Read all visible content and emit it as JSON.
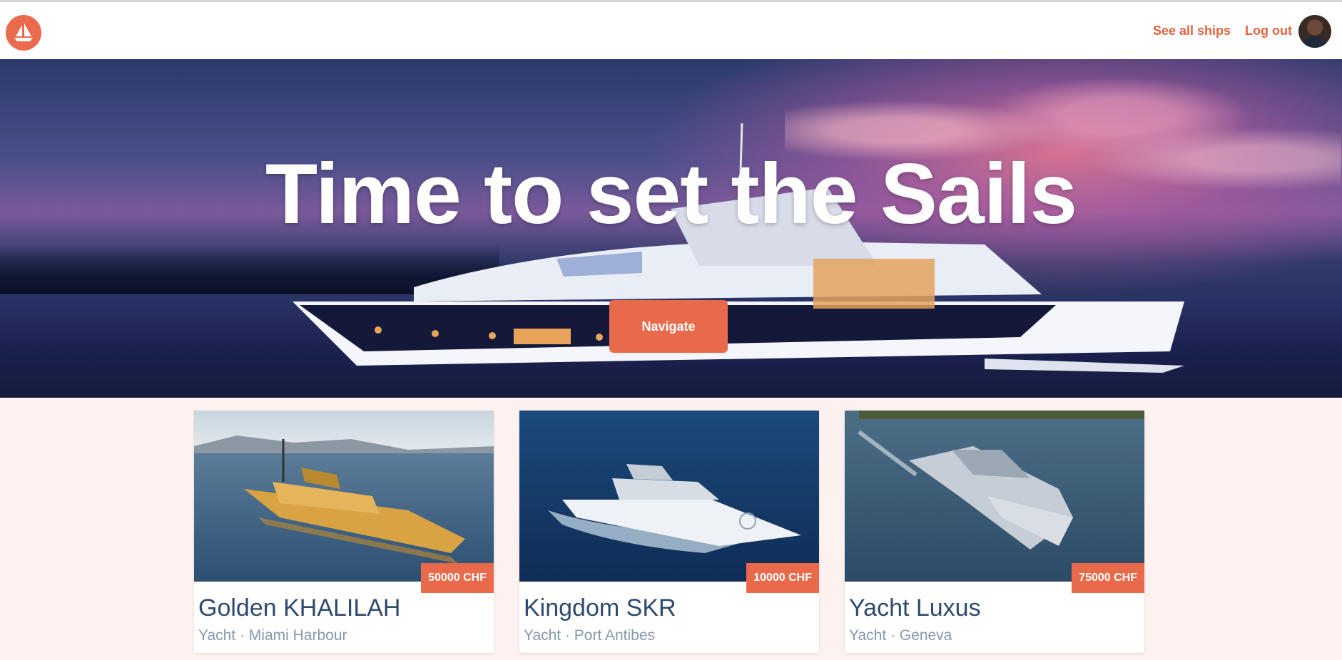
{
  "header": {
    "logo_icon": "sailboat-logo-icon",
    "nav": {
      "see_all_ships": "See all ships",
      "log_out": "Log out"
    },
    "avatar_icon": "user-avatar-icon"
  },
  "hero": {
    "title": "Time to set the Sails",
    "button_label": "Navigate"
  },
  "ships": [
    {
      "name": "Golden KHALILAH",
      "subtitle": "Yacht · Miami Harbour",
      "price": "50000 CHF"
    },
    {
      "name": "Kingdom SKR",
      "subtitle": "Yacht · Port Antibes",
      "price": "10000 CHF"
    },
    {
      "name": "Yacht Luxus",
      "subtitle": "Yacht · Geneva",
      "price": "75000 CHF"
    }
  ],
  "colors": {
    "accent": "#e86a4b",
    "title_text": "#2e4a6f",
    "subtitle_text": "#8798ad",
    "page_bg": "#fdf2ef"
  }
}
